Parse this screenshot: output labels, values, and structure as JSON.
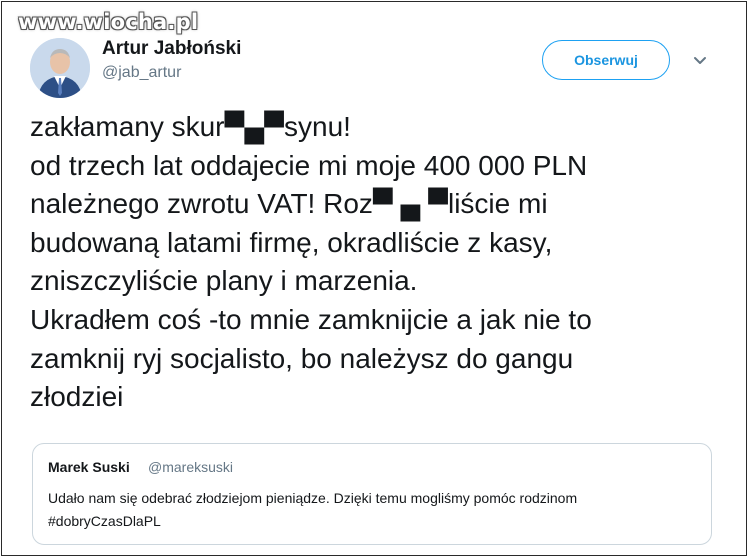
{
  "watermark": "www.wiocha.pl",
  "tweet": {
    "author_name": "Artur Jabłoński",
    "author_handle": "@jab_artur",
    "follow_label": "Obserwuj",
    "icons": {
      "avatar": "profile-photo",
      "more": "chevron-down-icon"
    },
    "text_lines": [
      "zakłamany skur▀▄▀synu!",
      "od trzech lat oddajecie mi moje 400 000 PLN",
      "należnego zwrotu VAT! Roz▀ ▄ ▀liście mi",
      "budowaną latami firmę, okradliście z kasy,",
      "zniszczyliście plany i marzenia.",
      "Ukradłem coś -to mnie zamknijcie a jak nie to",
      "zamknij ryj socjalisto, bo należysz do gangu",
      "złodziei"
    ]
  },
  "quoted_tweet": {
    "author_name": "Marek Suski",
    "author_handle": "@mareksuski",
    "text_lines": [
      "Udało nam się odebrać złodziejom pieniądze. Dzięki temu mogliśmy pomóc rodzinom",
      "#dobryCzasDlaPL"
    ]
  },
  "colors": {
    "link_blue": "#1da1f2",
    "handle_gray": "#657786",
    "text": "#14171a",
    "border": "#ccd6dd"
  }
}
